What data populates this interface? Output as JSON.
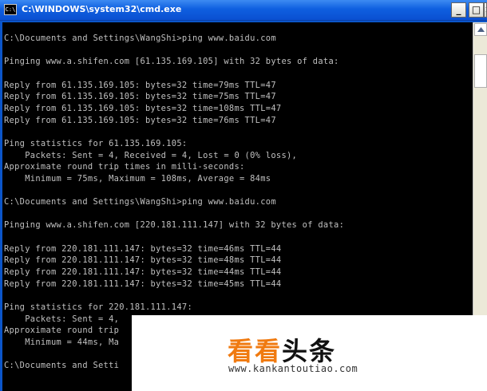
{
  "window": {
    "title": "C:\\WINDOWS\\system32\\cmd.exe",
    "icon_label": "C:\\",
    "min_label": "_",
    "max_label": "□",
    "close_label": "×"
  },
  "console": {
    "lines": [
      "C:\\Documents and Settings\\WangShi>ping www.baidu.com",
      "",
      "Pinging www.a.shifen.com [61.135.169.105] with 32 bytes of data:",
      "",
      "Reply from 61.135.169.105: bytes=32 time=79ms TTL=47",
      "Reply from 61.135.169.105: bytes=32 time=75ms TTL=47",
      "Reply from 61.135.169.105: bytes=32 time=108ms TTL=47",
      "Reply from 61.135.169.105: bytes=32 time=76ms TTL=47",
      "",
      "Ping statistics for 61.135.169.105:",
      "    Packets: Sent = 4, Received = 4, Lost = 0 (0% loss),",
      "Approximate round trip times in milli-seconds:",
      "    Minimum = 75ms, Maximum = 108ms, Average = 84ms",
      "",
      "C:\\Documents and Settings\\WangShi>ping www.baidu.com",
      "",
      "Pinging www.a.shifen.com [220.181.111.147] with 32 bytes of data:",
      "",
      "Reply from 220.181.111.147: bytes=32 time=46ms TTL=44",
      "Reply from 220.181.111.147: bytes=32 time=48ms TTL=44",
      "Reply from 220.181.111.147: bytes=32 time=44ms TTL=44",
      "Reply from 220.181.111.147: bytes=32 time=45ms TTL=44",
      "",
      "Ping statistics for 220.181.111.147:",
      "    Packets: Sent = 4,",
      "Approximate round trip",
      "    Minimum = 44ms, Ma",
      "",
      "C:\\Documents and Setti"
    ]
  },
  "watermark": {
    "logo_part1": "看看",
    "logo_part2": "头条",
    "url": "www.kankantoutiao.com"
  },
  "colors": {
    "titlebar": "#0a4fd0",
    "console_bg": "#000000",
    "console_text": "#c0c0c0",
    "logo_orange": "#f07a10"
  }
}
